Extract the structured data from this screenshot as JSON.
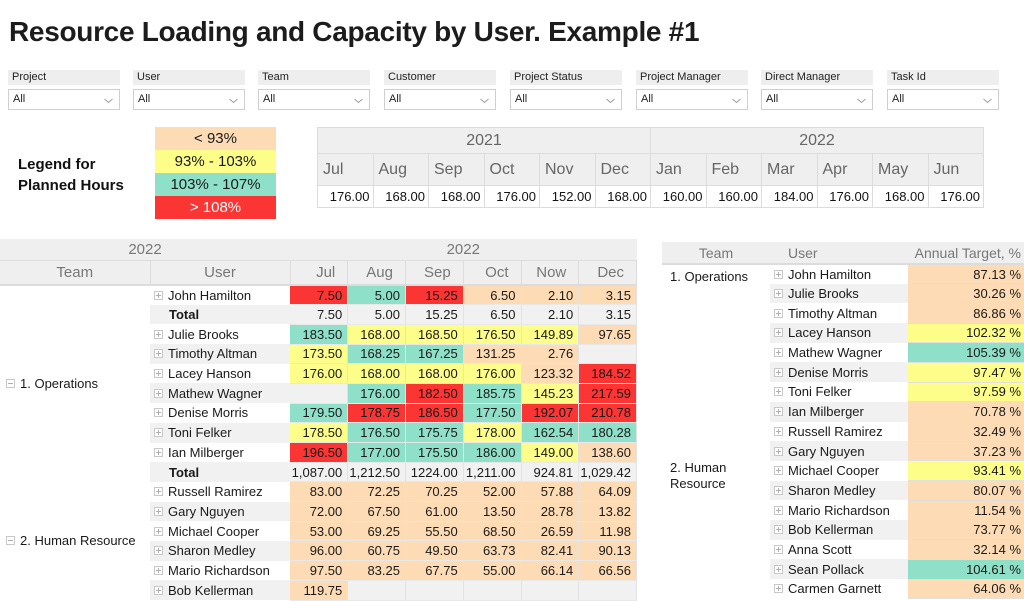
{
  "title": "Resource Loading and Capacity by User. Example #1",
  "filters": [
    {
      "label": "Project",
      "value": "All"
    },
    {
      "label": "User",
      "value": "All"
    },
    {
      "label": "Team",
      "value": "All"
    },
    {
      "label": "Customer",
      "value": "All"
    },
    {
      "label": "Project Status",
      "value": "All"
    },
    {
      "label": "Project Manager",
      "value": "All"
    },
    {
      "label": "Direct Manager",
      "value": "All"
    },
    {
      "label": "Task Id",
      "value": "All"
    }
  ],
  "legend": {
    "title_line1": "Legend for",
    "title_line2": "Planned Hours",
    "items": [
      {
        "label": "< 93%",
        "color": "#fddcb5",
        "key": "orange"
      },
      {
        "label": "93% - 103%",
        "color": "#fdfd8a",
        "key": "yellow"
      },
      {
        "label": "103% - 107%",
        "color": "#8fe0c8",
        "key": "teal"
      },
      {
        "label": "> 108%",
        "color": "#fb3434",
        "key": "red"
      }
    ]
  },
  "capacity": {
    "years": [
      {
        "label": "2021",
        "months": [
          "Jul",
          "Aug",
          "Sep",
          "Oct",
          "Nov",
          "Dec"
        ],
        "values": [
          "176.00",
          "168.00",
          "168.00",
          "176.00",
          "152.00",
          "168.00"
        ]
      },
      {
        "label": "2022",
        "months": [
          "Jan",
          "Feb",
          "Mar",
          "Apr",
          "May",
          "Jun"
        ],
        "values": [
          "160.00",
          "160.00",
          "184.00",
          "176.00",
          "168.00",
          "176.00"
        ]
      }
    ]
  },
  "loading": {
    "year_left": "2022",
    "year_right": "2022",
    "headers": {
      "team": "Team",
      "user": "User",
      "months": [
        "Jul",
        "Aug",
        "Sep",
        "Oct",
        "Now",
        "Dec"
      ]
    },
    "groups": [
      {
        "team": "1. Operations",
        "rows": [
          {
            "user": "John Hamilton",
            "type": "user",
            "cells": [
              [
                "7.50",
                "red"
              ],
              [
                "5.00",
                "teal"
              ],
              [
                "15.25",
                "red"
              ],
              [
                "6.50",
                "orange"
              ],
              [
                "2.10",
                "orange"
              ],
              [
                "3.15",
                "orange"
              ]
            ]
          },
          {
            "user": "Total",
            "type": "total",
            "cells": [
              [
                "7.50",
                ""
              ],
              [
                "5.00",
                ""
              ],
              [
                "15.25",
                ""
              ],
              [
                "6.50",
                ""
              ],
              [
                "2.10",
                ""
              ],
              [
                "3.15",
                ""
              ]
            ]
          },
          {
            "user": "Julie Brooks",
            "type": "user",
            "cells": [
              [
                "183.50",
                "teal"
              ],
              [
                "168.00",
                "yellow"
              ],
              [
                "168.50",
                "yellow"
              ],
              [
                "176.50",
                "yellow"
              ],
              [
                "149.89",
                "yellow"
              ],
              [
                "97.65",
                "orange"
              ]
            ]
          },
          {
            "user": "Timothy Altman",
            "type": "user",
            "cells": [
              [
                "173.50",
                "yellow"
              ],
              [
                "168.25",
                "teal"
              ],
              [
                "167.25",
                "teal"
              ],
              [
                "131.25",
                "orange"
              ],
              [
                "2.76",
                "orange"
              ],
              [
                "",
                "none"
              ]
            ]
          },
          {
            "user": "Lacey Hanson",
            "type": "user",
            "cells": [
              [
                "176.00",
                "yellow"
              ],
              [
                "168.00",
                "yellow"
              ],
              [
                "168.00",
                "yellow"
              ],
              [
                "176.00",
                "yellow"
              ],
              [
                "123.32",
                "orange"
              ],
              [
                "184.52",
                "red"
              ]
            ]
          },
          {
            "user": "Mathew Wagner",
            "type": "user",
            "cells": [
              [
                "",
                "none"
              ],
              [
                "176.00",
                "teal"
              ],
              [
                "182.50",
                "red"
              ],
              [
                "185.75",
                "teal"
              ],
              [
                "145.23",
                "yellow"
              ],
              [
                "217.59",
                "red"
              ]
            ]
          },
          {
            "user": "Denise Morris",
            "type": "user",
            "cells": [
              [
                "179.50",
                "teal"
              ],
              [
                "178.75",
                "red"
              ],
              [
                "186.50",
                "red"
              ],
              [
                "177.50",
                "teal"
              ],
              [
                "192.07",
                "red"
              ],
              [
                "210.78",
                "red"
              ]
            ]
          },
          {
            "user": "Toni Felker",
            "type": "user",
            "cells": [
              [
                "178.50",
                "yellow"
              ],
              [
                "176.50",
                "teal"
              ],
              [
                "175.75",
                "teal"
              ],
              [
                "178.00",
                "yellow"
              ],
              [
                "162.54",
                "teal"
              ],
              [
                "180.28",
                "teal"
              ]
            ]
          },
          {
            "user": "Ian Milberger",
            "type": "user",
            "cells": [
              [
                "196.50",
                "red"
              ],
              [
                "177.00",
                "teal"
              ],
              [
                "175.50",
                "teal"
              ],
              [
                "186.00",
                "teal"
              ],
              [
                "149.00",
                "yellow"
              ],
              [
                "138.60",
                "orange"
              ]
            ]
          },
          {
            "user": "Total",
            "type": "total",
            "cells": [
              [
                "1,087.00",
                ""
              ],
              [
                "1,212.50",
                ""
              ],
              [
                "1224.00",
                ""
              ],
              [
                "1,211.00",
                ""
              ],
              [
                "924.81",
                ""
              ],
              [
                "1,029.42",
                ""
              ]
            ]
          }
        ]
      },
      {
        "team": "2. Human Resource",
        "rows": [
          {
            "user": "Russell Ramirez",
            "type": "user",
            "cells": [
              [
                "83.00",
                "orange"
              ],
              [
                "72.25",
                "orange"
              ],
              [
                "70.25",
                "orange"
              ],
              [
                "52.00",
                "orange"
              ],
              [
                "57.88",
                "orange"
              ],
              [
                "64.09",
                "orange"
              ]
            ]
          },
          {
            "user": "Gary Nguyen",
            "type": "user",
            "cells": [
              [
                "72.00",
                "orange"
              ],
              [
                "67.50",
                "orange"
              ],
              [
                "61.00",
                "orange"
              ],
              [
                "13.50",
                "orange"
              ],
              [
                "28.78",
                "orange"
              ],
              [
                "13.82",
                "orange"
              ]
            ]
          },
          {
            "user": "Michael Cooper",
            "type": "user",
            "cells": [
              [
                "53.00",
                "orange"
              ],
              [
                "69.25",
                "orange"
              ],
              [
                "55.50",
                "orange"
              ],
              [
                "68.50",
                "orange"
              ],
              [
                "26.59",
                "orange"
              ],
              [
                "11.98",
                "orange"
              ]
            ]
          },
          {
            "user": "Sharon Medley",
            "type": "user",
            "cells": [
              [
                "96.00",
                "orange"
              ],
              [
                "60.75",
                "orange"
              ],
              [
                "49.50",
                "orange"
              ],
              [
                "63.73",
                "orange"
              ],
              [
                "82.41",
                "orange"
              ],
              [
                "90.13",
                "orange"
              ]
            ]
          },
          {
            "user": "Mario Richardson",
            "type": "user",
            "cells": [
              [
                "97.50",
                "orange"
              ],
              [
                "83.25",
                "orange"
              ],
              [
                "67.75",
                "orange"
              ],
              [
                "55.00",
                "orange"
              ],
              [
                "66.14",
                "orange"
              ],
              [
                "66.56",
                "orange"
              ]
            ]
          },
          {
            "user": "Bob Kellerman",
            "type": "user",
            "cells": [
              [
                "119.75",
                "orange"
              ],
              [
                "",
                "none"
              ],
              [
                "",
                "none"
              ],
              [
                "",
                "none"
              ],
              [
                "",
                "none"
              ],
              [
                "",
                "none"
              ]
            ]
          }
        ]
      }
    ]
  },
  "annual": {
    "headers": {
      "team": "Team",
      "user": "User",
      "target": "Annual Target, %"
    },
    "groups": [
      {
        "team": "1. Operations",
        "rows": [
          {
            "user": "John Hamilton",
            "value": "87.13 %",
            "color": "orange"
          },
          {
            "user": "Julie Brooks",
            "value": "30.26 %",
            "color": "orange"
          },
          {
            "user": "Timothy Altman",
            "value": "86.86 %",
            "color": "orange"
          },
          {
            "user": "Lacey Hanson",
            "value": "102.32 %",
            "color": "yellow"
          },
          {
            "user": "Mathew Wagner",
            "value": "105.39 %",
            "color": "teal"
          },
          {
            "user": "Denise Morris",
            "value": "97.47 %",
            "color": "yellow"
          },
          {
            "user": "Toni Felker",
            "value": "97.59 %",
            "color": "yellow"
          },
          {
            "user": "Ian Milberger",
            "value": "70.78 %",
            "color": "orange"
          }
        ]
      },
      {
        "team": "2. Human Resource",
        "rows": [
          {
            "user": "Russell Ramirez",
            "value": "32.49 %",
            "color": "orange"
          },
          {
            "user": "Gary Nguyen",
            "value": "37.23 %",
            "color": "orange"
          },
          {
            "user": "Michael Cooper",
            "value": "93.41 %",
            "color": "yellow"
          },
          {
            "user": "Sharon Medley",
            "value": "80.07 %",
            "color": "orange"
          },
          {
            "user": "Mario Richardson",
            "value": "11.54 %",
            "color": "orange"
          },
          {
            "user": "Bob Kellerman",
            "value": "73.77 %",
            "color": "orange"
          },
          {
            "user": "Anna Scott",
            "value": "32.14 %",
            "color": "orange"
          },
          {
            "user": "Sean Pollack",
            "value": "104.61 %",
            "color": "teal"
          },
          {
            "user": "Carmen Garnett",
            "value": "64.06 %",
            "color": "orange"
          }
        ]
      }
    ]
  }
}
